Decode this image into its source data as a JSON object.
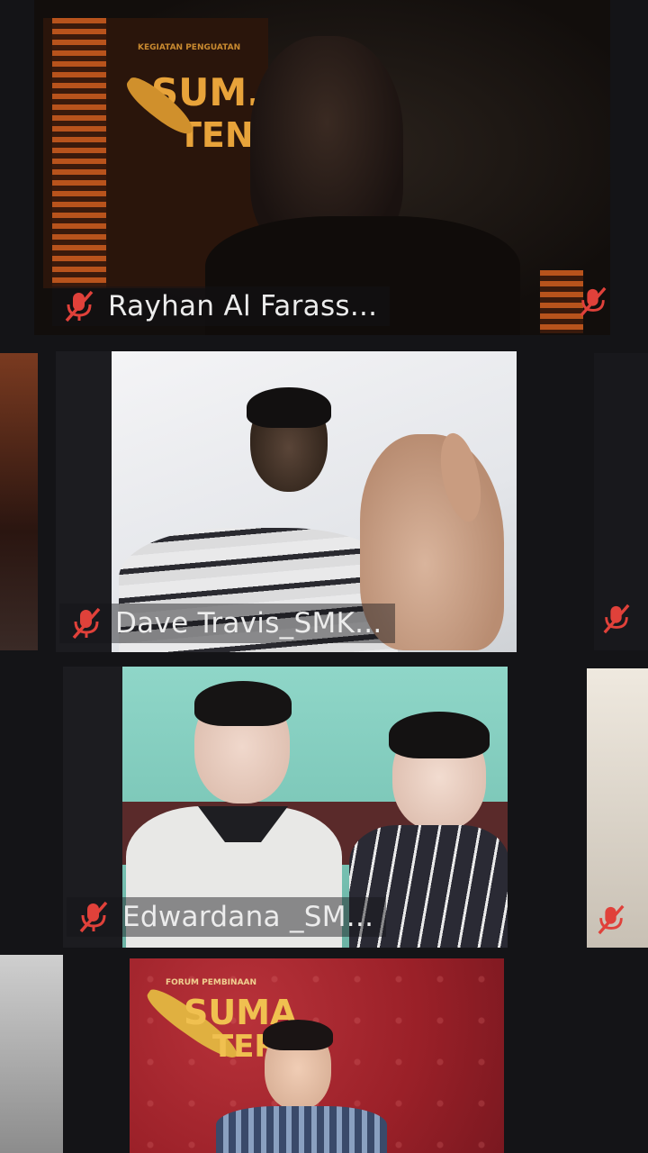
{
  "participants": [
    {
      "name": "Rayhan Al Farass...",
      "muted": true
    },
    {
      "name": "Dave Travis_SMK...",
      "muted": true
    },
    {
      "name": "Edwardana _SM...",
      "muted": true
    }
  ],
  "banners": {
    "top": {
      "line1": "SUM.",
      "line2": "TEN",
      "small": "KEGIATAN PENGUATAN"
    },
    "bottom": {
      "line1": "SUMA",
      "line2": "TER",
      "small": "FORUM PEMBINAAN"
    }
  },
  "colors": {
    "muted_icon": "#e0413a",
    "banner_red": "#a8262e",
    "label_text": "#ececec"
  },
  "icons": {
    "mute": "mic-off-icon"
  }
}
